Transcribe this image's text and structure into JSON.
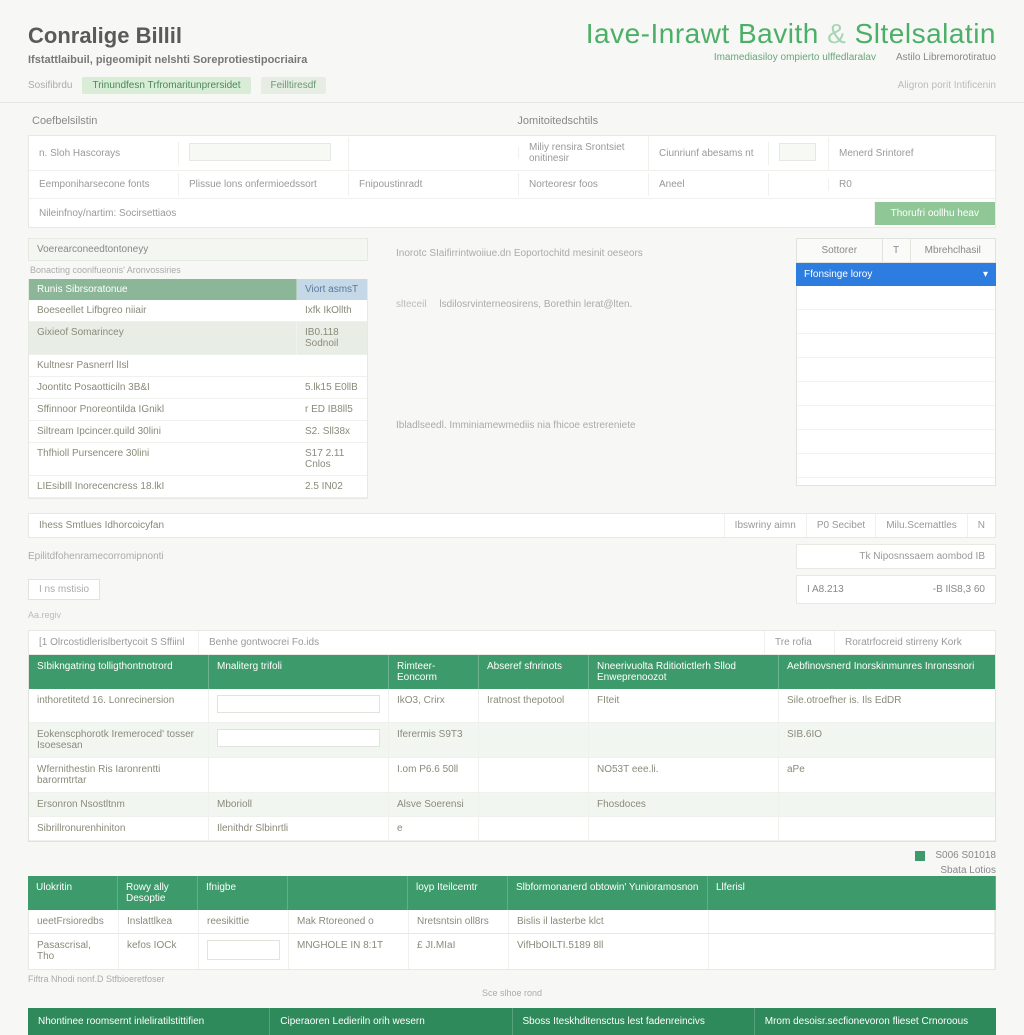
{
  "header": {
    "app_title": "Conralige Billil",
    "main_title_left": "Iave-Inrawt Bavith",
    "main_title_sep": "&",
    "main_title_right": "Sltelsalatin",
    "subtitle": "Ifstattlaibuil, pigeomipit nelshti Soreprotiestipocriaira",
    "subnav_a": "Imamediasiloy ompierto ulffedlaralav",
    "subnav_b": "Astilo Libremorotiratuo"
  },
  "toolbar": {
    "label": "Sosifibrdu",
    "pill1": "Trinundfesn Trfromaritunprersidet",
    "pill2": "Feilltiresdf",
    "right": "Aligron porit Intificenin"
  },
  "seclabels": {
    "a": "Coefbelsilstin",
    "b": "Jomitoitedschtils"
  },
  "form": {
    "r1c1": "n. Sloh Hascorays",
    "r1c4": "Miliy rensira Srontsiet onitinesir",
    "r1c5": "Ciunriunf abesams nt",
    "r1c7": "Menerd Srintoref",
    "r2c1": "Eemponiharsecone fonts",
    "r2c2": "Plissue lons onfermioedssort",
    "r2c3": "Fnipoustinradt",
    "r2c4": "Norteoresr foos",
    "r2c5": "Aneel",
    "r2c7": "R0",
    "r3c1": "Nileinfnoy/nartim: Socirsettiaos",
    "btn": "Thorufri oollhu heav"
  },
  "left": {
    "panel_title": "Voerearconeedtontoneyy",
    "sub": "Bonacting coonlfueonis' Aronvossiries",
    "th1": "Runis Sibrsoratonue",
    "th2": "Viort asmsT",
    "rows": [
      {
        "label": "Boeseellet Lifbgreo niiair",
        "amount": "Ixfk IkOllth"
      },
      {
        "label": "Gixieof  Somarincey",
        "amount": "IB0.118 Sodnoil"
      },
      {
        "label": "Kultnesr  Pasnerrl lIsl",
        "amount": ""
      },
      {
        "label": "Joontitc  Posaotticiln  3B&I",
        "amount": "5.lk15  E0llB"
      },
      {
        "label": "Sffinnoor  Pnoreontilda  IGnikl",
        "amount": "r ED IB8ll5"
      },
      {
        "label": "Siltream  Ipcincer.quild 30lini",
        "amount": "S2. Sll38x"
      },
      {
        "label": "Thfhioll   Pursencere 30lini",
        "amount": "S17 2.11 Cnlos"
      },
      {
        "label": "LIEsibIll  Inorecencress  18.lkI",
        "amount": "2.5  IN02"
      }
    ]
  },
  "center": {
    "note": "Inorotc SIaifirrintwoiiue.dn Eoportochitd mesinit oeseors",
    "lbl1": "slteceil",
    "txt1": "lsdilosrvinterneosirens, Borethin lerat@lten.",
    "txt2": "Ibladlseedl. Imminiamewmediis nia fhicoe estrereniete"
  },
  "right": {
    "tab1": "Sottorer",
    "tab2": "Mbrehclhasil",
    "selected": "Ffonsinge loroy"
  },
  "bar": {
    "lead": "Ihess Smtlues Idhorcoicyfan",
    "r1": "Ibswriny aimn",
    "r2": "P0 Secibet",
    "r3": "Milu.Scemattles",
    "r4": "N"
  },
  "subbar": {
    "left": "Epilitdfohenramecorromipnonti",
    "chip": "I ns mstisio",
    "small": "Aa.regiv",
    "rcard1": "Tk Niposnssaem aombod IB",
    "rcard2a": "I A8.213",
    "rcard2b": "-B IlS8,3 60"
  },
  "strip": {
    "a": "[1 Olrcostidlerislbertycoit S Sffiinl",
    "b": "Benhe gontwocrei Fo.ids",
    "c": "Tre rofia",
    "d": "Roratrfocreid stirreny Kork"
  },
  "grid": {
    "h1": "SIbikngatring tolligthontnotrord",
    "h2": "Mnaliterg trifoli",
    "h3": "Rimteer-Eoncorm",
    "h4": "Abseref sfnrinots",
    "h5": "Nneerivuolta Rditiotictlerh Sllod Enweprenoozot",
    "h6": "Aebfinovsnerd Inorskinmunres Inronssnori",
    "rows": [
      {
        "c1": "inthoretitetd 16. Lonrecinersion",
        "c2": "",
        "c3": "IkO3, Crirx",
        "c4": "Iratnost thepotool",
        "c5": "FIteit",
        "c6": "Sile.otroefher is.  Ils  EdDR"
      },
      {
        "c1": "Eokenscphorotk Iremeroced' tosser Isoesesan",
        "c2": "",
        "c3": "Iferermis    S9T3",
        "c4": "",
        "c5": "",
        "c6": "SIB.6IO"
      },
      {
        "c1": "Wfernithestin Ris Iaronrentti barormtrtar",
        "c2": "",
        "c3": "I.om P6.6 50ll",
        "c4": "",
        "c5": "NO53T eee.li.",
        "c6": "aPe"
      },
      {
        "c1": "Ersonron Nsostltnm",
        "c2": "Mborioll",
        "c3": "Alsve Soerensi",
        "c4": "",
        "c5": "Fhosdoces",
        "c6": ""
      },
      {
        "c1": "Sibrillronurenhiniton",
        "c2": "Ilenithdr Slbinrtli",
        "c3": "e",
        "c4": "",
        "c5": "",
        "c6": ""
      }
    ]
  },
  "legend": {
    "a": "S006 S01018",
    "b": "Sbata Lotios"
  },
  "detail": {
    "h1": "Ulokritin",
    "h2": "Rowy  ally Desoptie",
    "h3": "Ifnigbe",
    "h4": "loyp Iteilcemtr",
    "h5": "Slbformonanerd obtowin'  Yunioramosnon",
    "h6": "Llferisl",
    "r1": {
      "c1": "ueetFrsioredbs",
      "c2": "Inslattlkea",
      "c3": "reesikittie",
      "c4": "Mak Rtoreoned o",
      "c5": "Nretsntsin oll8rs",
      "c6": "Bislis il lasterbe  klct"
    },
    "r2": {
      "c1": "Pasascrisal, Tho",
      "c2": "kefos IOCk",
      "c3": "MNGHOLE IN 8:1T",
      "c4": "£ JI.MIaI",
      "c5": "VifHbOILTI.5189 8ll"
    },
    "note": "Fiftra Nhodi nonf.D Stfbioeretfoser",
    "mid": "Sce slhoe rond"
  },
  "footer": {
    "a": "Nhontinee roomsernt inleliratilstittifien",
    "b": "Ciperaoren Ledieriln orih wesern",
    "c": "Sboss Iteskhditensctus lest fadenreincivs",
    "d": "Mrom desoisr.secfionevoron flieset Crnoroous"
  }
}
